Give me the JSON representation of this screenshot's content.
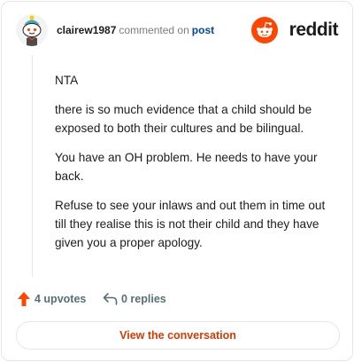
{
  "comment": {
    "username": "clairew1987",
    "action_text": "commented on",
    "post_link": "post",
    "avatar_icon": "snoo-avatar-icon",
    "paragraphs": [
      "NTA",
      "there is so much evidence that a child should be exposed to both their cultures and be bilingual.",
      "You have an OH problem. He needs to have your back.",
      "Refuse to see your inlaws and out them in time out till they realise this is not their child and they have given you a proper apology."
    ],
    "upvotes_label": "4 upvotes",
    "replies_label": "0 replies"
  },
  "brand": {
    "name": "reddit",
    "icon": "reddit-logo-icon",
    "color": "#ff4500"
  },
  "cta": {
    "label": "View the conversation",
    "color": "#d93900"
  },
  "colors": {
    "text": "#1c1c1c",
    "muted": "#576f76",
    "link": "#0045ac",
    "upvote": "#ff4500",
    "border": "#e4e6e8"
  }
}
